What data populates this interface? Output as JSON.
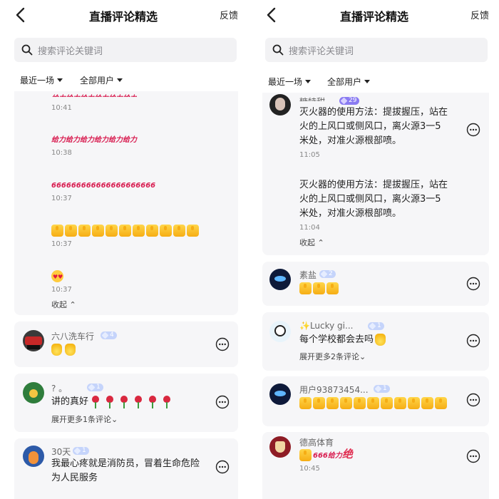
{
  "header": {
    "back_icon": "back-arrow-icon",
    "title": "直播评论精选",
    "feedback": "反馈"
  },
  "search": {
    "placeholder": "搜索评论关键词",
    "icon": "search-icon"
  },
  "filters": {
    "range": "最近一场",
    "users": "全部用户"
  },
  "left": {
    "top_card": {
      "times": [
        "10:41",
        "10:38",
        "10:37",
        "10:37",
        "10:37"
      ],
      "geili_text": "给力给力给力给力给力给力",
      "six_text": "666666666666666666666",
      "collapse": "收起"
    },
    "comments": [
      {
        "name": "六八洗车行",
        "level": "4",
        "message": ""
      },
      {
        "name": "? 。",
        "level": "1",
        "message": "讲的真好",
        "expand": "展开更多1条评论"
      },
      {
        "name": "30天",
        "level": "1",
        "message": "我最心疼就是消防员，冒着生命危险为人民服务"
      }
    ]
  },
  "right": {
    "top_card": {
      "name": "糖特甜",
      "level": "29",
      "message1": "灭火器的使用方法：提拔握压，站在火的上风口或侧风口，离火源3一5米处，对准火源根部喷。",
      "time1": "11:05",
      "message2": "灭火器的使用方法：提拔握压，站在火的上风口或侧风口，离火源3一5米处，对准火源根部喷。",
      "time2": "11:04",
      "collapse": "收起"
    },
    "comments": [
      {
        "name": "素盐",
        "level": "2"
      },
      {
        "name": "✨Lucky gi...",
        "level": "1",
        "message": "每个学校都会去吗",
        "expand": "展开更多2条评论"
      },
      {
        "name": "用户93873454...",
        "level": "1"
      },
      {
        "name": "德高体育",
        "message_geili": "给力",
        "message_six": "666",
        "message_jue": "绝",
        "time": "10:45"
      }
    ]
  },
  "colors": {
    "accent_badge": "#c5d4fb",
    "purple_badge": "#8a7bf2",
    "card_bg": "#f6f6f8"
  }
}
